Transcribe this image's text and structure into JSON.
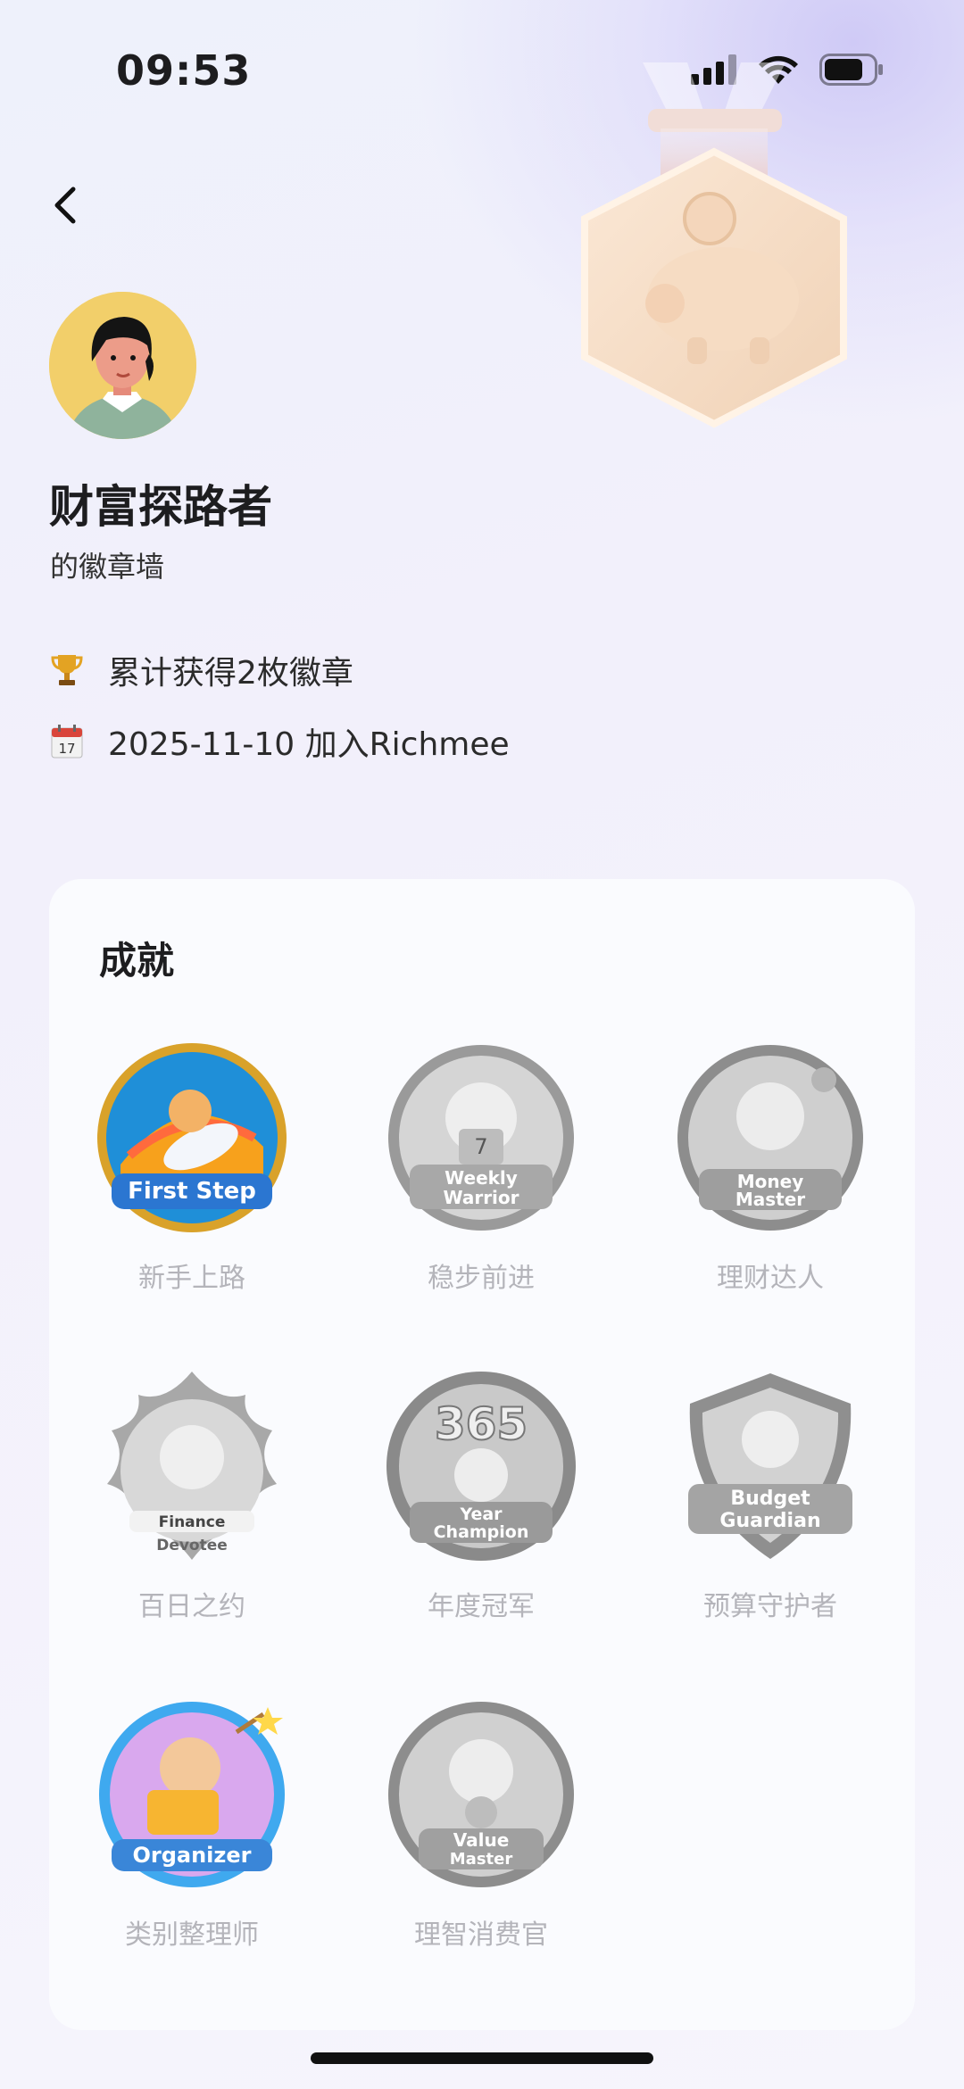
{
  "status_bar": {
    "time": "09:53"
  },
  "profile": {
    "name": "财富探路者",
    "subtitle": "的徽章墙",
    "badge_count_text": "累计获得2枚徽章",
    "join_text": "2025-11-10 加入Richmee"
  },
  "achievements": {
    "title": "成就",
    "badges": [
      {
        "label": "新手上路",
        "art_text": "First Step",
        "earned": true,
        "color": "#f5a623"
      },
      {
        "label": "稳步前进",
        "art_text": "Weekly Warrior",
        "earned": false
      },
      {
        "label": "理财达人",
        "art_text": "Money Master",
        "earned": false
      },
      {
        "label": "百日之约",
        "art_text": "Finance Devotee",
        "earned": false
      },
      {
        "label": "年度冠军",
        "art_text": "365 Year Champion",
        "earned": false
      },
      {
        "label": "预算守护者",
        "art_text": "Budget Guardian",
        "earned": false
      },
      {
        "label": "类别整理师",
        "art_text": "Organizer",
        "earned": true,
        "color": "#4fb6f0"
      },
      {
        "label": "理智消费官",
        "art_text": "Value Master",
        "earned": false
      }
    ]
  },
  "colors": {
    "accent_gold": "#f2cf6a",
    "text_muted": "#b4b4ba",
    "card_bg": "#fafbfe"
  }
}
